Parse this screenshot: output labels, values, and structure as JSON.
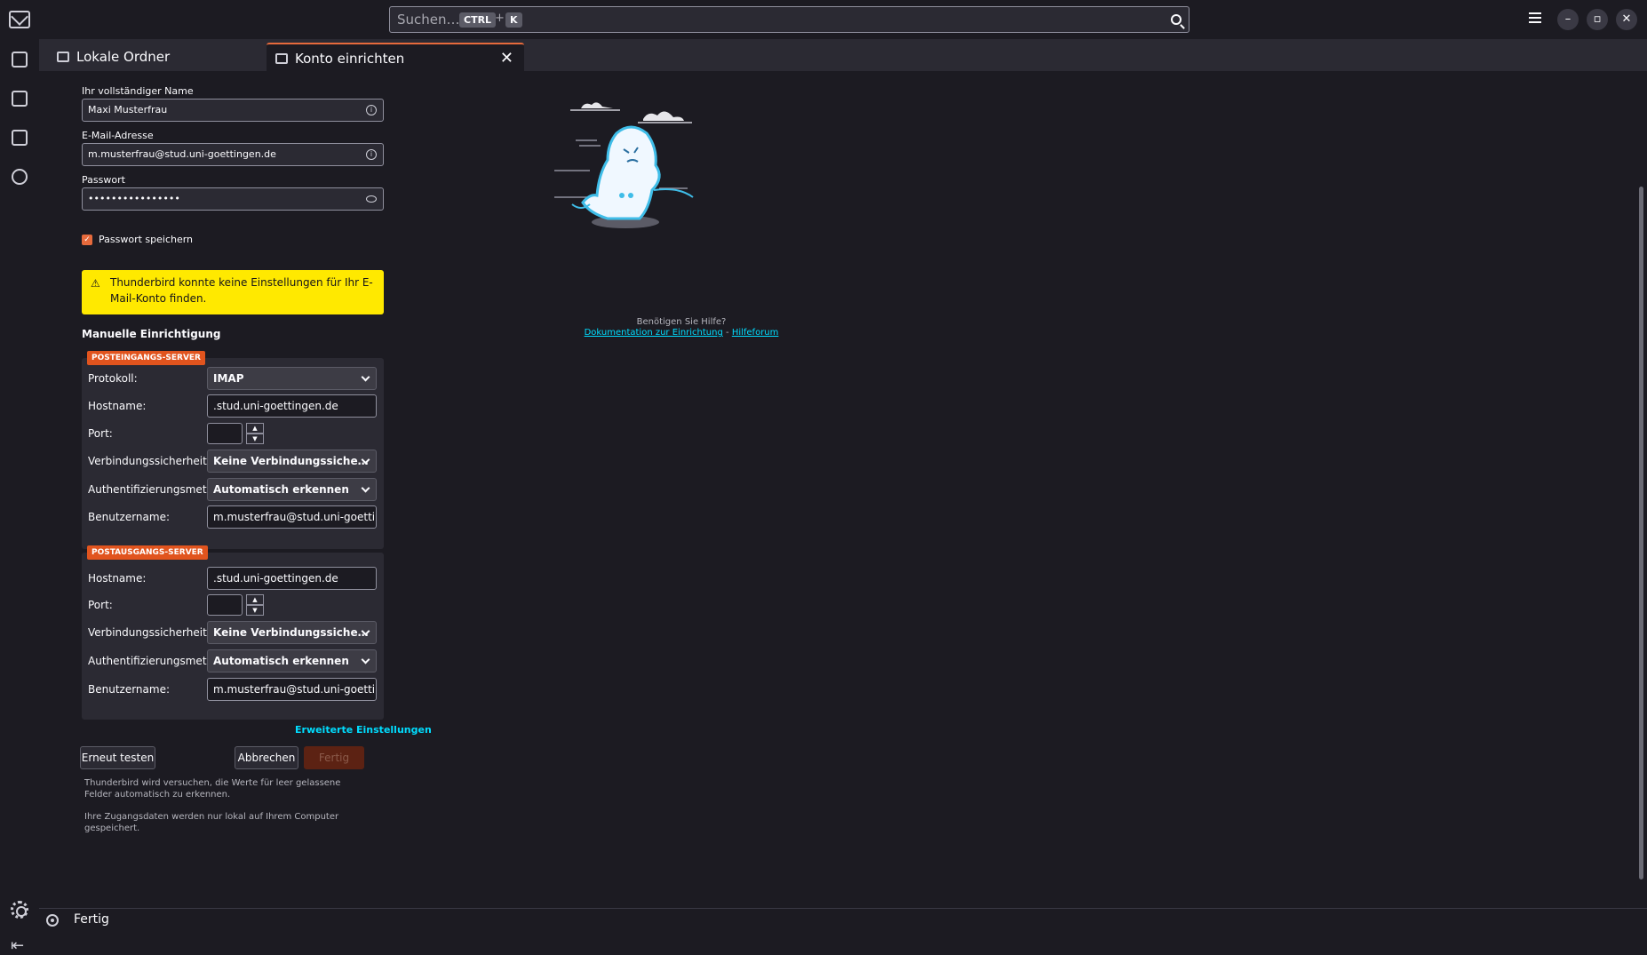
{
  "search": {
    "placeholder": "Suchen…",
    "kbd1": "CTRL",
    "plus": "+",
    "kbd2": "K"
  },
  "window": {
    "minimize": "–",
    "restore": "▫",
    "close": "✕"
  },
  "tabs": [
    {
      "label": "Lokale Ordner",
      "icon": "folder-icon"
    },
    {
      "label": "Konto einrichten",
      "icon": "account-setup-icon",
      "close": "✕"
    }
  ],
  "form": {
    "name_label": "Ihr vollständiger Name",
    "name_value": "Maxi Musterfrau",
    "email_label": "E-Mail-Adresse",
    "email_value": "m.musterfrau@stud.uni-goettingen.de",
    "password_label": "Passwort",
    "password_value": "••••••••••••••••",
    "remember_label": "Passwort speichern",
    "warning": "Thunderbird konnte keine Einstellungen für Ihr E-Mail-Konto finden.",
    "manual_title": "Manuelle Einrichtigung"
  },
  "incoming": {
    "badge": "POSTEINGANGS-SERVER",
    "protocol_label": "Protokoll:",
    "protocol_value": "IMAP",
    "hostname_label": "Hostname:",
    "hostname_value": ".stud.uni-goettingen.de",
    "port_label": "Port:",
    "security_label": "Verbindungssicherheit:",
    "security_value": "Keine Verbindungssiche…",
    "auth_label": "Authentifizierungsmethode:",
    "auth_value": "Automatisch erkennen",
    "username_label": "Benutzername:",
    "username_value": "m.musterfrau@stud.uni-goettingen.de"
  },
  "outgoing": {
    "badge": "POSTAUSGANGS-SERVER",
    "hostname_label": "Hostname:",
    "hostname_value": ".stud.uni-goettingen.de",
    "port_label": "Port:",
    "security_label": "Verbindungssicherheit:",
    "security_value": "Keine Verbindungssiche…",
    "auth_label": "Authentifizierungsmethode:",
    "auth_value": "Automatisch erkennen",
    "username_label": "Benutzername:",
    "username_value": "m.musterfrau@stud.uni-goettingen.de"
  },
  "actions": {
    "advanced": "Erweiterte Einstellungen",
    "retest": "Erneut testen",
    "cancel": "Abbrechen",
    "done": "Fertig"
  },
  "hints": {
    "autodetect": "Thunderbird wird versuchen, die Werte für leer gelassene Felder automatisch zu erkennen.",
    "local": "Ihre Zugangsdaten werden nur lokal auf Ihrem Computer gespeichert."
  },
  "help": {
    "question": "Benötigen Sie Hilfe?",
    "doc_link": "Dokumentation zur Einrichtung",
    "separator": " - ",
    "forum_link": "Hilfeforum"
  },
  "status": {
    "text": "Fertig"
  }
}
